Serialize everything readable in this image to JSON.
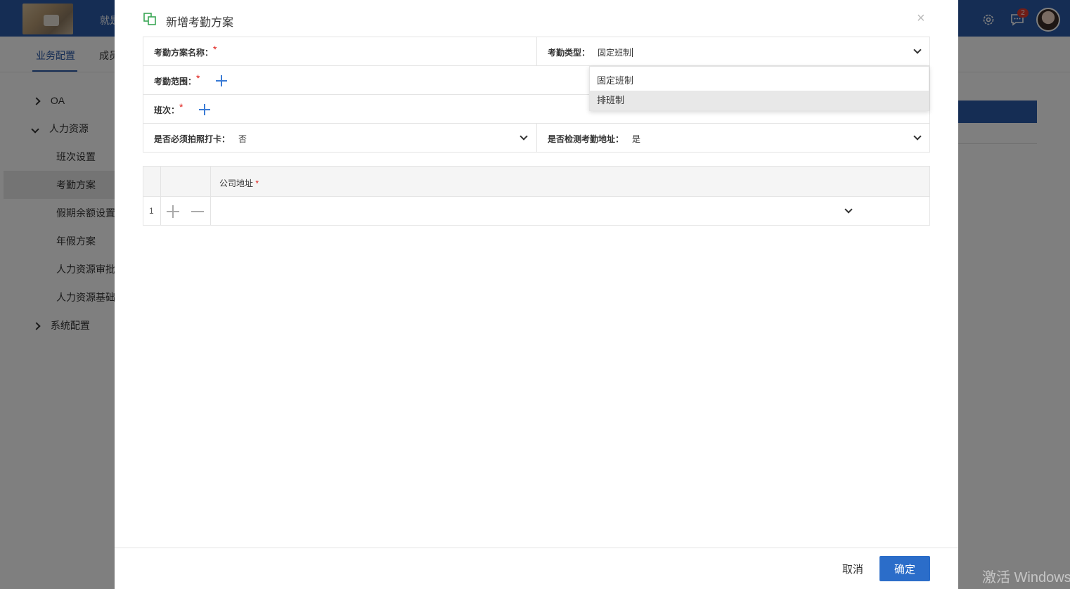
{
  "app": {
    "brand": "就是",
    "notification_count": "2"
  },
  "subnav": {
    "tabs": [
      {
        "label": "业务配置"
      },
      {
        "label": "成员"
      }
    ]
  },
  "sidebar": {
    "items": [
      {
        "label": "OA"
      },
      {
        "label": "人力资源"
      },
      {
        "label": "班次设置"
      },
      {
        "label": "考勤方案"
      },
      {
        "label": "假期余额设置"
      },
      {
        "label": "年假方案"
      },
      {
        "label": "人力资源审批"
      },
      {
        "label": "人力资源基础"
      },
      {
        "label": "系统配置"
      }
    ]
  },
  "modal": {
    "title": "新增考勤方案",
    "close": "×",
    "fields": {
      "name_label": "考勤方案名称：",
      "type_label": "考勤类型：",
      "type_value": "固定班制",
      "scope_label": "考勤范围：",
      "shift_label": "班次：",
      "photo_label": "是否必须拍照打卡：",
      "photo_value": "否",
      "address_check_label": "是否检测考勤地址：",
      "address_check_value": "是",
      "required_mark": "*"
    },
    "type_options": [
      "固定班制",
      "排班制"
    ],
    "grid": {
      "column": "公司地址",
      "row_number": "1"
    },
    "footer": {
      "cancel": "取消",
      "ok": "确定"
    }
  },
  "watermark": "激活 Windows"
}
